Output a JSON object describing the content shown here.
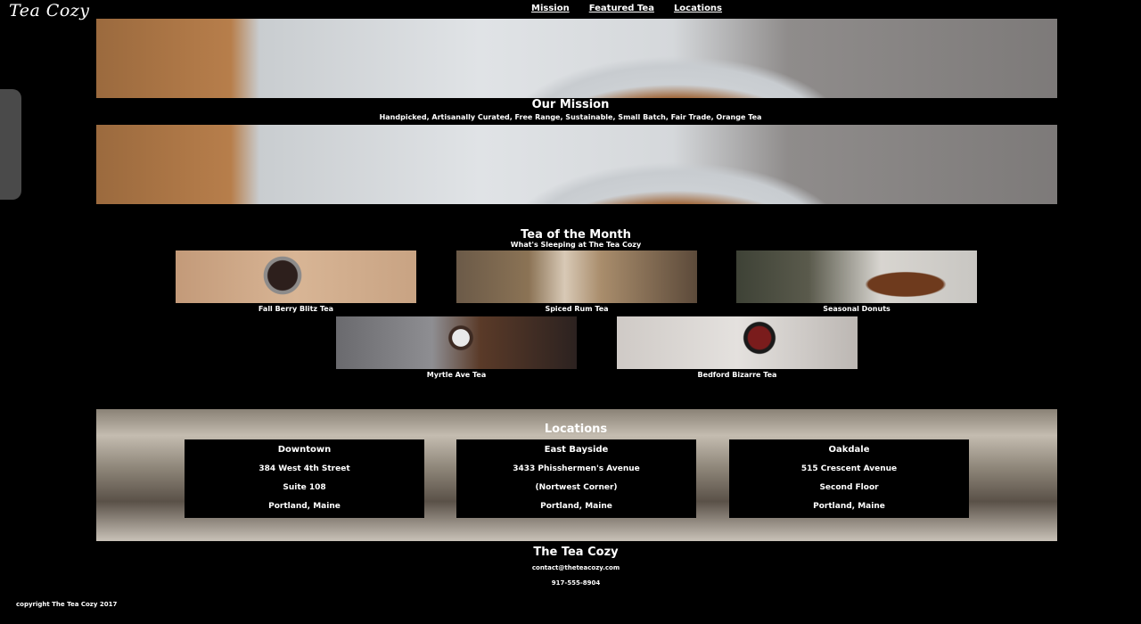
{
  "header": {
    "logo": "Tea Cozy",
    "nav": [
      "Mission",
      "Featured Tea",
      "Locations"
    ]
  },
  "mission": {
    "title": "Our Mission",
    "subtitle": "Handpicked, Artisanally Curated, Free Range, Sustainable, Small Batch, Fair Trade, Orange Tea"
  },
  "tea_of_month": {
    "title": "Tea of the Month",
    "subtitle": "What's Sleeping at The Tea Cozy",
    "items": [
      "Fall Berry Blitz Tea",
      "Spiced Rum Tea",
      "Seasonal Donuts",
      "Myrtle Ave Tea",
      "Bedford Bizarre Tea"
    ]
  },
  "locations": {
    "title": "Locations",
    "items": [
      {
        "name": "Downtown",
        "line1": "384 West 4th Street",
        "line2": "Suite 108",
        "line3": "Portland, Maine"
      },
      {
        "name": "East Bayside",
        "line1": "3433 Phisshermen's Avenue",
        "line2": "(Nortwest Corner)",
        "line3": "Portland, Maine"
      },
      {
        "name": "Oakdale",
        "line1": "515 Crescent Avenue",
        "line2": "Second Floor",
        "line3": "Portland, Maine"
      }
    ]
  },
  "footer": {
    "title": "The Tea Cozy",
    "email": "contact@theteacozy.com",
    "phone": "917-555-8904",
    "copyright": "copyright The Tea Cozy 2017"
  }
}
